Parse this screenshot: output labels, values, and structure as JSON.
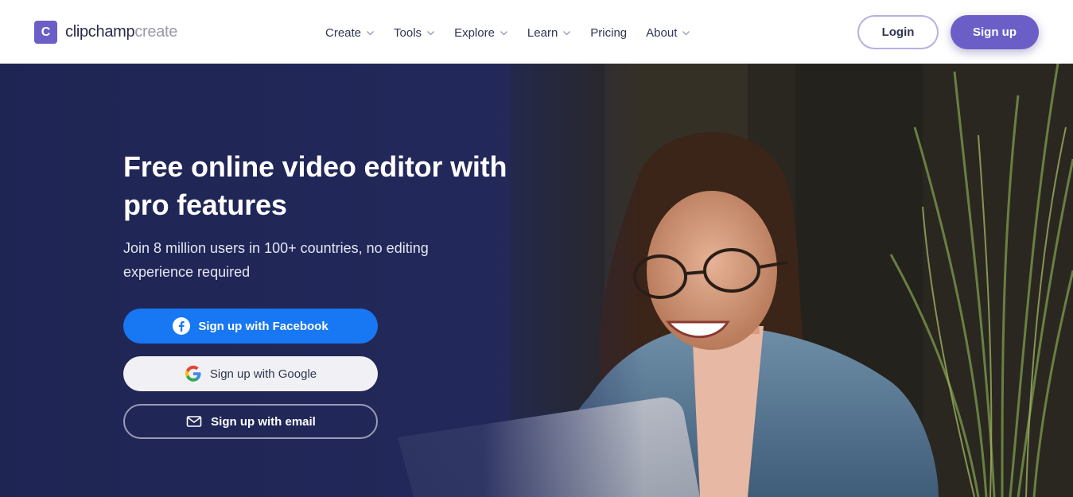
{
  "brand": {
    "logo_letter": "C",
    "name_main": "clipchamp",
    "name_suffix": "create",
    "color": "#6b5fc7"
  },
  "nav": {
    "items": [
      {
        "label": "Create",
        "has_dropdown": true
      },
      {
        "label": "Tools",
        "has_dropdown": true
      },
      {
        "label": "Explore",
        "has_dropdown": true
      },
      {
        "label": "Learn",
        "has_dropdown": true
      },
      {
        "label": "Pricing",
        "has_dropdown": false
      },
      {
        "label": "About",
        "has_dropdown": true
      }
    ],
    "login_label": "Login",
    "signup_label": "Sign up"
  },
  "hero": {
    "title": "Free online video editor with pro features",
    "subtitle": "Join 8 million users in 100+ countries, no editing experience required",
    "buttons": {
      "facebook": {
        "label": "Sign up with Facebook",
        "icon": "facebook-icon",
        "color": "#1877f2"
      },
      "google": {
        "label": "Sign up with Google",
        "icon": "google-icon"
      },
      "email": {
        "label": "Sign up with email",
        "icon": "mail-icon"
      }
    }
  },
  "colors": {
    "hero_bg": "#1f2553",
    "nav_text": "#2f3650",
    "accent": "#6b5fc7"
  }
}
